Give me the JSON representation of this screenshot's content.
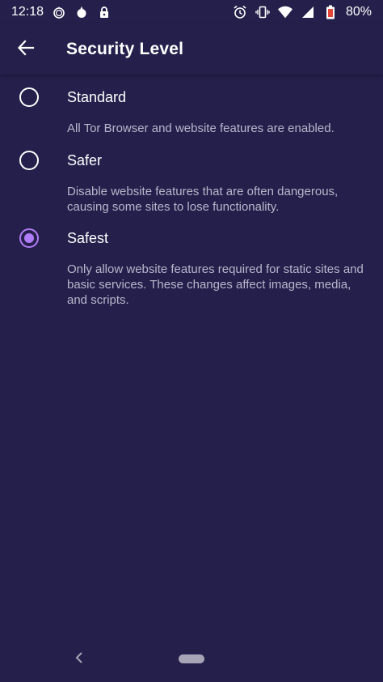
{
  "status_bar": {
    "time": "12:18",
    "battery": "80%",
    "icons": [
      "tor-onion-icon",
      "tor-onion-filled-icon",
      "lock-icon",
      "alarm-icon",
      "vibrate-icon",
      "wifi-icon",
      "signal-icon",
      "battery-icon"
    ]
  },
  "app_bar": {
    "title": "Security Level",
    "back_icon": "arrow-left-icon"
  },
  "options": [
    {
      "label": "Standard",
      "description": "All Tor Browser and website features are enabled.",
      "selected": false
    },
    {
      "label": "Safer",
      "description": "Disable website features that are often dangerous, causing some sites to lose functionality.",
      "selected": false
    },
    {
      "label": "Safest",
      "description": "Only allow website features required for static sites and basic services. These changes affect images, media, and scripts.",
      "selected": true
    }
  ],
  "colors": {
    "background": "#251f4b",
    "accent": "#b17cf7",
    "secondary_text": "#b9b6cc"
  },
  "nav_bar": {
    "back_icon": "nav-back-chevron-icon",
    "home_icon": "nav-home-pill-icon"
  }
}
